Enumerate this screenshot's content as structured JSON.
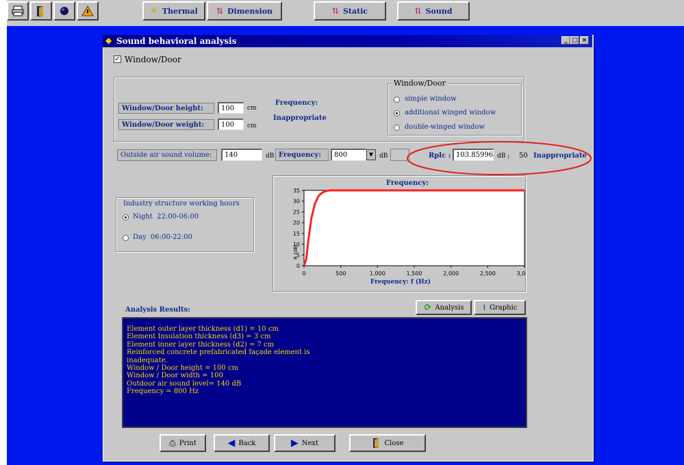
{
  "toolbar": {
    "thermal_label": "Thermal",
    "dimension_label": "Dimension",
    "static_label": "Static",
    "sound_label": "Sound"
  },
  "dialog": {
    "title": "Sound behavioral analysis",
    "window_door_checkbox_label": "Window/Door",
    "window_door_checked": true
  },
  "dimensions": {
    "height_label": "Window/Door height:",
    "height_value": "100",
    "height_unit": "cm",
    "weight_label": "Window/Door weight:",
    "weight_value": "100",
    "weight_unit": "cm",
    "frequency_label": "Frequency:",
    "frequency_status": "Inappropriate"
  },
  "window_type": {
    "group_label": "Window/Door",
    "options": [
      "simple window",
      "additional winged window",
      "double-winged window"
    ],
    "selected": "additional winged window"
  },
  "sound": {
    "outside_label": "Outside air sound volume:",
    "outside_value": "140",
    "outside_unit": "dB",
    "frequency_label": "Frequency:",
    "frequency_value": "800",
    "frequency_unit": "dB",
    "rplc_label": "Rplc :",
    "rplc_value": "103.85996",
    "rplc_unit": "dB ;",
    "rplc_limit": "50",
    "rplc_status": "Inappropriate"
  },
  "hours": {
    "group_label": "Industry structure working hours",
    "options": [
      "Night  22:00-06:00",
      "Day  06:00-22:00"
    ],
    "selected": "Night  22:00-06:00"
  },
  "chart_data": {
    "type": "line",
    "title": "Frequency:",
    "xlabel": "Frequency:  f (Hz)",
    "ylabel": "R (dB)",
    "xlim": [
      0,
      3000
    ],
    "ylim": [
      0,
      35
    ],
    "xticks": [
      "0",
      "500",
      "1,000",
      "1,500",
      "2,000",
      "2,500",
      "3,000"
    ],
    "yticks": [
      "0",
      "5",
      "10",
      "15",
      "20",
      "25",
      "30",
      "35"
    ],
    "color": "#ff2020",
    "series": [
      {
        "x": [
          0,
          30,
          60,
          100,
          150,
          200,
          250,
          300,
          350,
          400,
          500,
          700,
          1000,
          2000,
          3000
        ],
        "y": [
          0,
          3,
          12,
          22,
          29,
          32.5,
          34,
          34.7,
          35,
          35,
          35,
          35,
          35,
          35,
          35
        ]
      }
    ]
  },
  "results": {
    "heading": "Analysis Results:",
    "lines": [
      "Element outer layer thickness (d1) = 10 cm",
      "Element Insulation thickness (d3) = 3 cm",
      "Element inner layer thickness (d2) = 7 cm",
      "Reinforced concrete prefabricated façade element is",
      "inadequate.",
      "Window / Door height = 100 cm",
      "Window / Door width = 100",
      "Outdoor air sound level= 140 dB",
      "Frequency = 800 Hz"
    ],
    "analysis_button": "Analysis",
    "graphic_button": "Graphic"
  },
  "bottom_buttons": {
    "print": "Print",
    "back": "Back",
    "next": "Next",
    "close": "Close"
  },
  "colors": {
    "desktop": "#0018f0",
    "results_bg": "#00008b",
    "results_text": "#ffd700",
    "highlight_ellipse": "#e02020",
    "curve": "#ff2020"
  }
}
